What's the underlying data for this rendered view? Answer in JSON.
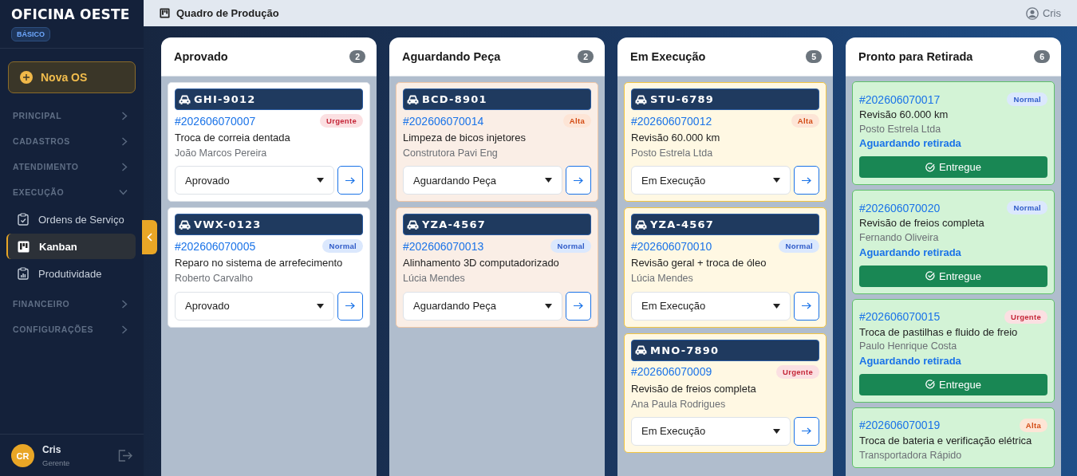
{
  "sidebar": {
    "brand": "OFICINA OESTE",
    "plan": "BÁSICO",
    "new_button": "Nova OS",
    "nav": [
      {
        "label": "PRINCIPAL",
        "expanded": false
      },
      {
        "label": "CADASTROS",
        "expanded": false
      },
      {
        "label": "ATENDIMENTO",
        "expanded": false
      },
      {
        "label": "EXECUÇÃO",
        "expanded": true,
        "children": [
          {
            "label": "Ordens de Serviço",
            "selected": false
          },
          {
            "label": "Kanban",
            "selected": true
          },
          {
            "label": "Produtividade",
            "selected": false
          }
        ]
      },
      {
        "label": "FINANCEIRO",
        "expanded": false
      },
      {
        "label": "CONFIGURAÇÕES",
        "expanded": false
      }
    ],
    "user": {
      "initials": "CR",
      "name": "Cris",
      "role": "Gerente"
    }
  },
  "topbar": {
    "title": "Quadro de Produção",
    "user": "Cris"
  },
  "columns": [
    {
      "title": "Aprovado",
      "count": "2",
      "kind": "approved",
      "cards": [
        {
          "kind": "active",
          "plate": "GHI-9012",
          "order": "#202606070007",
          "priority": {
            "label": "Urgente",
            "kind": "urgent"
          },
          "service": "Troca de correia dentada",
          "customer": "João Marcos Pereira",
          "status": "Aprovado"
        },
        {
          "kind": "active",
          "plate": "VWX-0123",
          "order": "#202606070005",
          "priority": {
            "label": "Normal",
            "kind": "normal"
          },
          "service": "Reparo no sistema de arrefecimento",
          "customer": "Roberto Carvalho",
          "status": "Aprovado"
        }
      ]
    },
    {
      "title": "Aguardando Peça",
      "count": "2",
      "kind": "waiting",
      "cards": [
        {
          "kind": "active",
          "plate": "BCD-8901",
          "order": "#202606070014",
          "priority": {
            "label": "Alta",
            "kind": "high"
          },
          "service": "Limpeza de bicos injetores",
          "customer": "Construtora Pavi Eng",
          "status": "Aguardando Peça"
        },
        {
          "kind": "active",
          "plate": "YZA-4567",
          "order": "#202606070013",
          "priority": {
            "label": "Normal",
            "kind": "normal"
          },
          "service": "Alinhamento 3D computadorizado",
          "customer": "Lúcia Mendes",
          "status": "Aguardando Peça"
        }
      ]
    },
    {
      "title": "Em Execução",
      "count": "5",
      "kind": "running",
      "cards": [
        {
          "kind": "active",
          "plate": "STU-6789",
          "order": "#202606070012",
          "priority": {
            "label": "Alta",
            "kind": "high"
          },
          "service": "Revisão 60.000 km",
          "customer": "Posto Estrela Ltda",
          "status": "Em Execução"
        },
        {
          "kind": "active",
          "plate": "YZA-4567",
          "order": "#202606070010",
          "priority": {
            "label": "Normal",
            "kind": "normal"
          },
          "service": "Revisão geral + troca de óleo",
          "customer": "Lúcia Mendes",
          "status": "Em Execução"
        },
        {
          "kind": "active",
          "plate": "MNO-7890",
          "order": "#202606070009",
          "priority": {
            "label": "Urgente",
            "kind": "urgent"
          },
          "service": "Revisão de freios completa",
          "customer": "Ana Paula Rodrigues",
          "status": "Em Execução"
        }
      ]
    },
    {
      "title": "Pronto para Retirada",
      "count": "6",
      "kind": "ready",
      "cards": [
        {
          "kind": "ready",
          "order": "#202606070017",
          "priority": {
            "label": "Normal",
            "kind": "normal"
          },
          "service": "Revisão 60.000 km",
          "customer": "Posto Estrela Ltda",
          "note": "Aguardando retirada",
          "action": "Entregue"
        },
        {
          "kind": "ready",
          "order": "#202606070020",
          "priority": {
            "label": "Normal",
            "kind": "normal"
          },
          "service": "Revisão de freios completa",
          "customer": "Fernando Oliveira",
          "note": "Aguardando retirada",
          "action": "Entregue"
        },
        {
          "kind": "ready",
          "order": "#202606070015",
          "priority": {
            "label": "Urgente",
            "kind": "urgent"
          },
          "service": "Troca de pastilhas e fluido de freio",
          "customer": "Paulo Henrique Costa",
          "note": "Aguardando retirada",
          "action": "Entregue"
        },
        {
          "kind": "ready",
          "order": "#202606070019",
          "priority": {
            "label": "Alta",
            "kind": "high"
          },
          "service": "Troca de bateria e verificação elétrica",
          "customer": "Transportadora Rápido"
        }
      ]
    }
  ]
}
